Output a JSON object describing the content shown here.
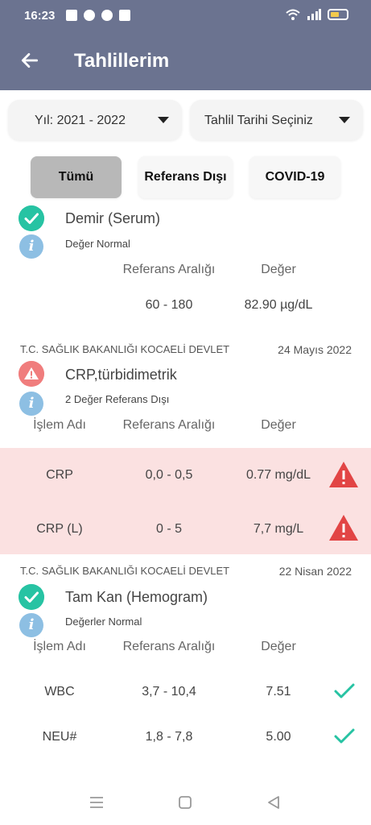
{
  "status_bar": {
    "time": "16:23"
  },
  "app_bar": {
    "title": "Tahlillerim"
  },
  "filters": {
    "year": "Yıl: 2021 - 2022",
    "date": "Tahlil Tarihi Seçiniz"
  },
  "tabs": [
    {
      "label": "Tümü"
    },
    {
      "label": "Referans Dışı"
    },
    {
      "label": "COVID-19"
    }
  ],
  "results": [
    {
      "name": "Demir (Serum)",
      "status_text": "Değer Normal",
      "columns": {
        "reference": "Referans Aralığı",
        "value": "Değer"
      },
      "rows": [
        {
          "reference": "60 - 180",
          "value": "82.90 µg/dL"
        }
      ]
    },
    {
      "hospital": "T.C. SAĞLIK BAKANLIĞI KOCAELİ DEVLET",
      "date": "24 Mayıs 2022",
      "name": "CRP,türbidimetrik",
      "status_text": "2 Değer Referans Dışı",
      "columns": {
        "name": "İşlem Adı",
        "reference": "Referans Aralığı",
        "value": "Değer"
      },
      "rows": [
        {
          "name": "CRP",
          "reference": "0,0 - 0,5",
          "value": "0.77 mg/dL"
        },
        {
          "name": "CRP (L)",
          "reference": "0 - 5",
          "value": "7,7 mg/L"
        }
      ]
    },
    {
      "hospital": "T.C. SAĞLIK BAKANLIĞI KOCAELİ DEVLET",
      "date": "22 Nisan 2022",
      "name": "Tam Kan (Hemogram)",
      "status_text": "Değerler Normal",
      "columns": {
        "name": "İşlem Adı",
        "reference": "Referans Aralığı",
        "value": "Değer"
      },
      "rows": [
        {
          "name": "WBC",
          "reference": "3,7 - 10,4",
          "value": "7.51"
        },
        {
          "name": "NEU#",
          "reference": "1,8 - 7,8",
          "value": "5.00"
        }
      ]
    }
  ],
  "colors": {
    "header": "#6b7390",
    "ok": "#27c3a3",
    "warning": "#e24545",
    "abnormal_row": "#fbe1e1",
    "info": "#8dbfe3"
  }
}
